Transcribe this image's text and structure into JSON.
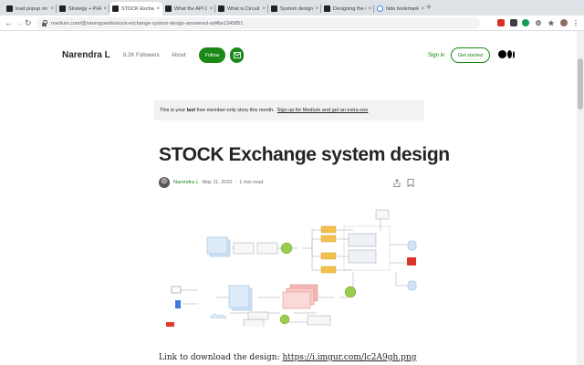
{
  "browser": {
    "tabs": [
      {
        "label": "load popup on bu",
        "favicon": "medium-icon"
      },
      {
        "label": "Strategy + PHP 8 | M",
        "favicon": "medium-icon"
      },
      {
        "label": "STOCK Exchange sy",
        "favicon": "medium-icon",
        "active": true
      },
      {
        "label": "What the API Gatew",
        "favicon": "medium-icon"
      },
      {
        "label": "What is Circuit Bre",
        "favicon": "medium-icon"
      },
      {
        "label": "System design Co",
        "favicon": "medium-icon"
      },
      {
        "label": "Designing the Co",
        "favicon": "medium-icon"
      },
      {
        "label": "hide bookmark ba",
        "favicon": "google-icon"
      }
    ],
    "close_glyph": "×",
    "new_tab_glyph": "+",
    "url": "medium.com/@narengowda/stock-exchange-system-design-answered-ad4be1345851"
  },
  "header": {
    "author": "Narendra L",
    "followers": "8.2K Followers",
    "about": "About",
    "follow": "Follow",
    "sign_in": "Sign in",
    "get_started": "Get started"
  },
  "banner": {
    "prefix": "This is your ",
    "bold": "last",
    "middle": " free member-only story this month.",
    "link": "Sign up for Medium and get an extra one"
  },
  "article": {
    "title": "STOCK Exchange system design",
    "author": "Narendra L",
    "date": "May 11, 2020",
    "separator": "·",
    "read_time": "1 min read",
    "link_prefix": "Link to download the design: ",
    "link_url": "https://i.imgur.com/lc2A9gh.png"
  },
  "colors": {
    "medium_green": "#1a8917",
    "text": "#242424",
    "muted": "#6b6b6b",
    "banner_bg": "#f2f2f2"
  }
}
